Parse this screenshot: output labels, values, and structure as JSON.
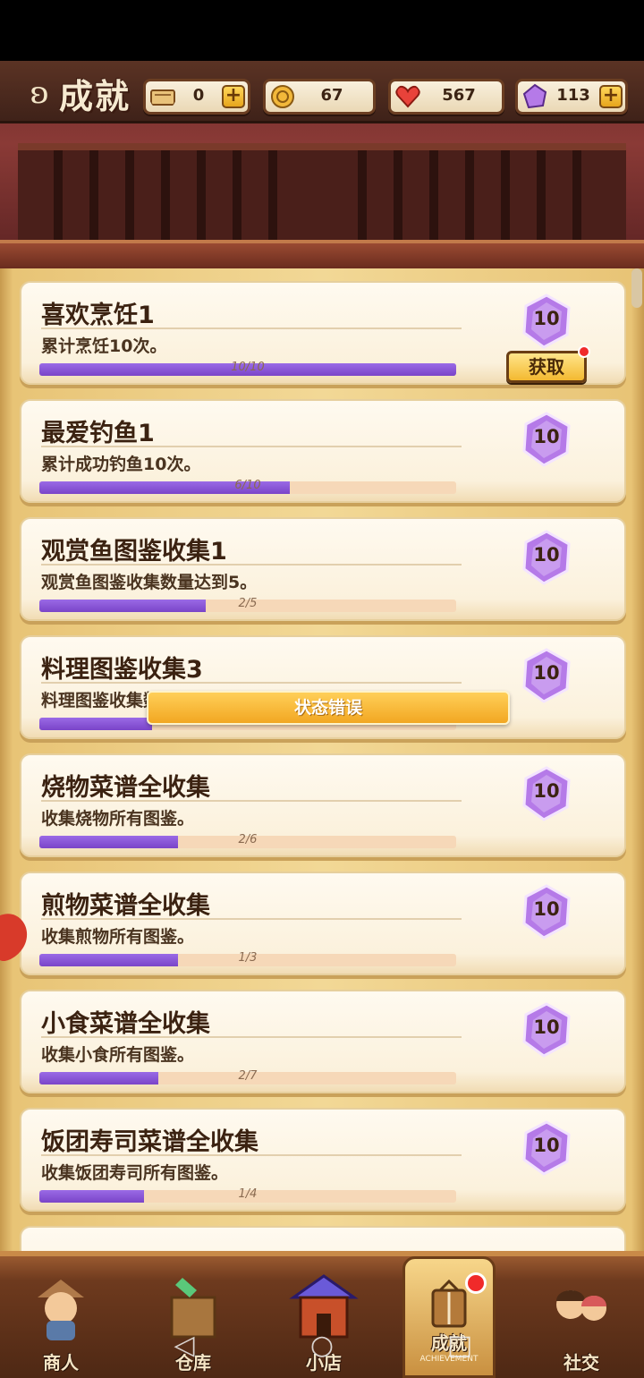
{
  "header": {
    "title": "成就"
  },
  "resources": [
    {
      "name": "ticket",
      "value": "0",
      "has_plus": true,
      "icon": "ticket-icon"
    },
    {
      "name": "coin",
      "value": "67",
      "has_plus": false,
      "icon": "coin-icon"
    },
    {
      "name": "heart",
      "value": "567",
      "has_plus": false,
      "icon": "heart-icon"
    },
    {
      "name": "gem",
      "value": "113",
      "has_plus": true,
      "icon": "gem-icon"
    }
  ],
  "achievements": [
    {
      "name": "喜欢烹饪1",
      "desc": "累计烹饪10次。",
      "progress_text": "10/10",
      "progress": 1.0,
      "reward": "10",
      "claim_label": "获取",
      "claimable": true
    },
    {
      "name": "最爱钓鱼1",
      "desc": "累计成功钓鱼10次。",
      "progress_text": "6/10",
      "progress": 0.6,
      "reward": "10",
      "claimable": false
    },
    {
      "name": "观赏鱼图鉴收集1",
      "desc": "观赏鱼图鉴收集数量达到5。",
      "progress_text": "2/5",
      "progress": 0.4,
      "reward": "10",
      "claimable": false
    },
    {
      "name": "料理图鉴收集3",
      "desc": "料理图鉴收集数量达到30",
      "progress_text": "",
      "progress": 0.27,
      "reward": "10",
      "claimable": false
    },
    {
      "name": "烧物菜谱全收集",
      "desc": "收集烧物所有图鉴。",
      "progress_text": "2/6",
      "progress": 0.333,
      "reward": "10",
      "claimable": false
    },
    {
      "name": "煎物菜谱全收集",
      "desc": "收集煎物所有图鉴。",
      "progress_text": "1/3",
      "progress": 0.333,
      "reward": "10",
      "claimable": false
    },
    {
      "name": "小食菜谱全收集",
      "desc": "收集小食所有图鉴。",
      "progress_text": "2/7",
      "progress": 0.286,
      "reward": "10",
      "claimable": false
    },
    {
      "name": "饭团寿司菜谱全收集",
      "desc": "收集饭团寿司所有图鉴。",
      "progress_text": "1/4",
      "progress": 0.25,
      "reward": "10",
      "claimable": false
    }
  ],
  "toast": {
    "text": "状态错误"
  },
  "bottom_nav": [
    {
      "label": "商人",
      "icon": "merchant-icon",
      "active": false
    },
    {
      "label": "仓库",
      "icon": "warehouse-icon",
      "active": false
    },
    {
      "label": "小店",
      "icon": "shop-icon",
      "active": false
    },
    {
      "label": "成就",
      "sub": "ACHIEVEMENT",
      "icon": "achievement-icon",
      "active": true,
      "badge": true
    },
    {
      "label": "社交",
      "icon": "social-icon",
      "active": false
    }
  ],
  "colors": {
    "progress_fill": "#7a44c8",
    "progress_track": "#f6d8b8",
    "gem": "#b57ae8",
    "claim_button": "#f3b930",
    "badge": "#f02a2a"
  }
}
